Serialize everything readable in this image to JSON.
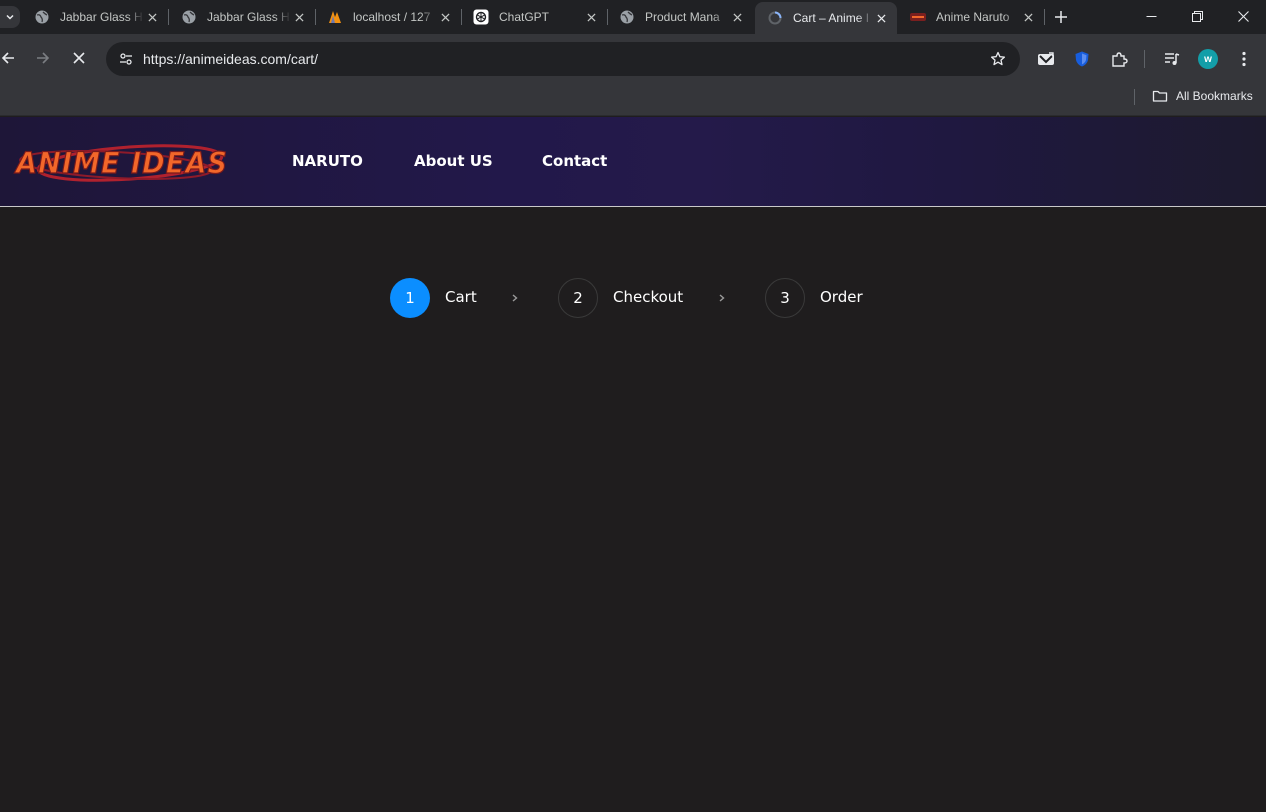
{
  "browser": {
    "tabs": [
      {
        "title": "Jabbar Glass H",
        "icon": "globe-icon",
        "active": false
      },
      {
        "title": "Jabbar Glass H",
        "icon": "globe-icon",
        "active": false
      },
      {
        "title": "localhost / 127",
        "icon": "phpmyadmin-icon",
        "active": false
      },
      {
        "title": "ChatGPT",
        "icon": "chatgpt-icon",
        "active": false
      },
      {
        "title": "Product Mana",
        "icon": "globe-icon",
        "active": false
      },
      {
        "title": "Cart – Anime I",
        "icon": "loading-icon",
        "active": true
      },
      {
        "title": "Anime Naruto",
        "icon": "site-favicon",
        "active": false
      }
    ],
    "url": "https://animeideas.com/cart/",
    "profile_initial": "w",
    "bookmarks_label": "All Bookmarks"
  },
  "site": {
    "logo_text": "ANIME IDEAS",
    "nav": [
      "NARUTO",
      "About US",
      "Contact"
    ]
  },
  "checkout_steps": [
    {
      "number": "1",
      "label": "Cart",
      "active": true
    },
    {
      "number": "2",
      "label": "Checkout",
      "active": false
    },
    {
      "number": "3",
      "label": "Order",
      "active": false
    }
  ],
  "colors": {
    "accent": "#0b8eff",
    "page_bg": "#1f1d1e",
    "header_bg": "#22184a",
    "logo_fill": "#f2672a"
  }
}
